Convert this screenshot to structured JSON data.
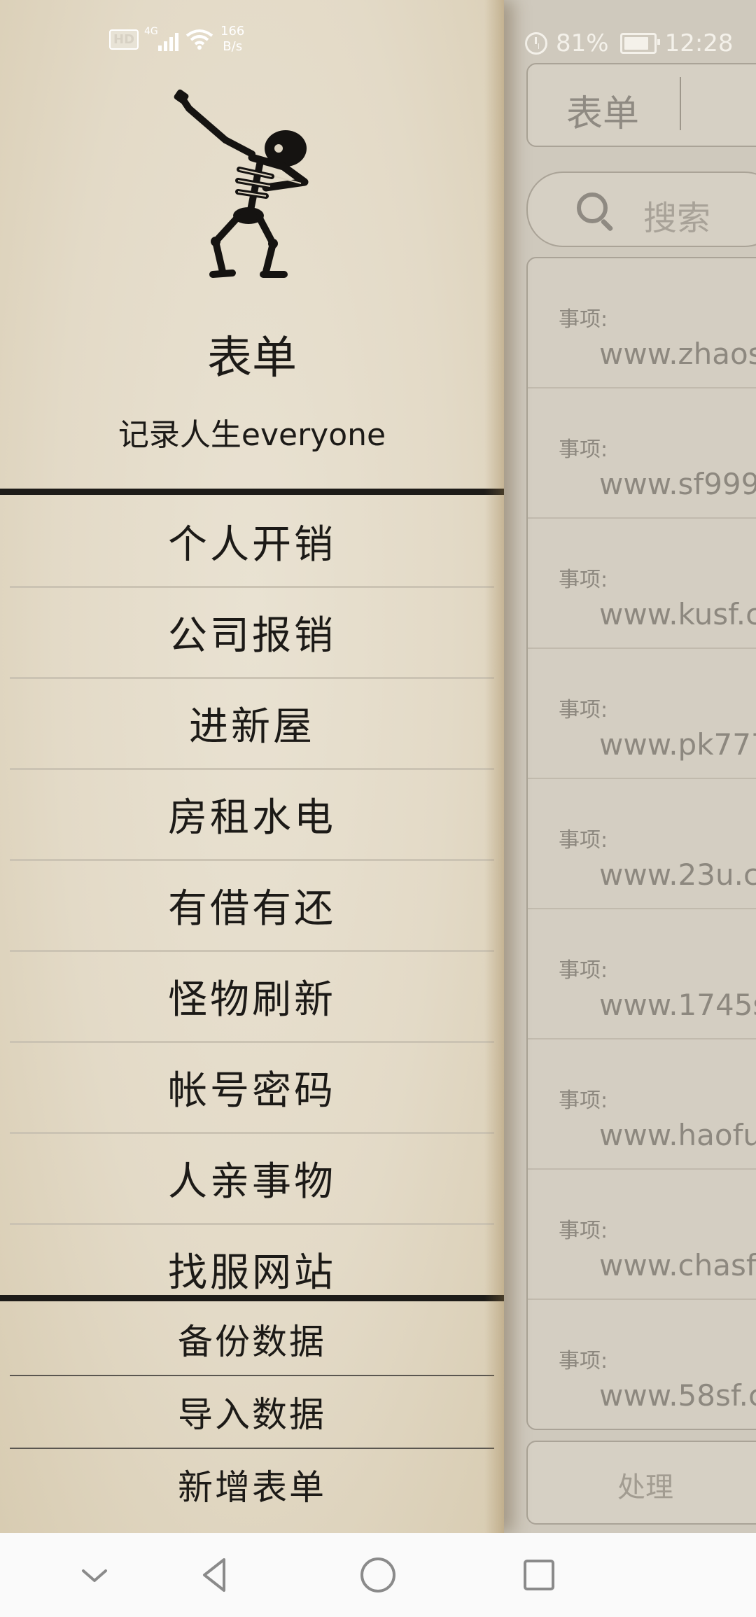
{
  "status_bar": {
    "left": {
      "hd": "HD",
      "network": "4G",
      "speed_value": "166",
      "speed_unit": "B/s"
    },
    "right": {
      "battery": "81%",
      "time": "12:28"
    }
  },
  "background": {
    "title": "表单",
    "search_placeholder": "搜索",
    "rows": [
      {
        "label": "事项:",
        "value": "www.zhaos"
      },
      {
        "label": "事项:",
        "value": "www.sf999"
      },
      {
        "label": "事项:",
        "value": "www.kusf.c"
      },
      {
        "label": "事项:",
        "value": "www.pk777"
      },
      {
        "label": "事项:",
        "value": "www.23u.c"
      },
      {
        "label": "事项:",
        "value": "www.1745s"
      },
      {
        "label": "事项:",
        "value": "www.haofu"
      },
      {
        "label": "事项:",
        "value": "www.chasf"
      },
      {
        "label": "事项:",
        "value": "www.58sf.c"
      }
    ],
    "action_button": "处理"
  },
  "drawer": {
    "title": "表单",
    "subtitle": "记录人生everyone",
    "menu_items": [
      "个人开销",
      "公司报销",
      "进新屋",
      "房租水电",
      "有借有还",
      "怪物刷新",
      "帐号密码",
      "人亲事物",
      "找服网站"
    ],
    "bottom_actions": [
      "备份数据",
      "导入数据",
      "新增表单"
    ]
  },
  "icons": {
    "logo": "dabbing-skeleton-logo",
    "search": "search-icon",
    "nav": [
      "chevron-down-icon",
      "back-triangle-icon",
      "home-circle-icon",
      "recents-square-icon"
    ]
  }
}
